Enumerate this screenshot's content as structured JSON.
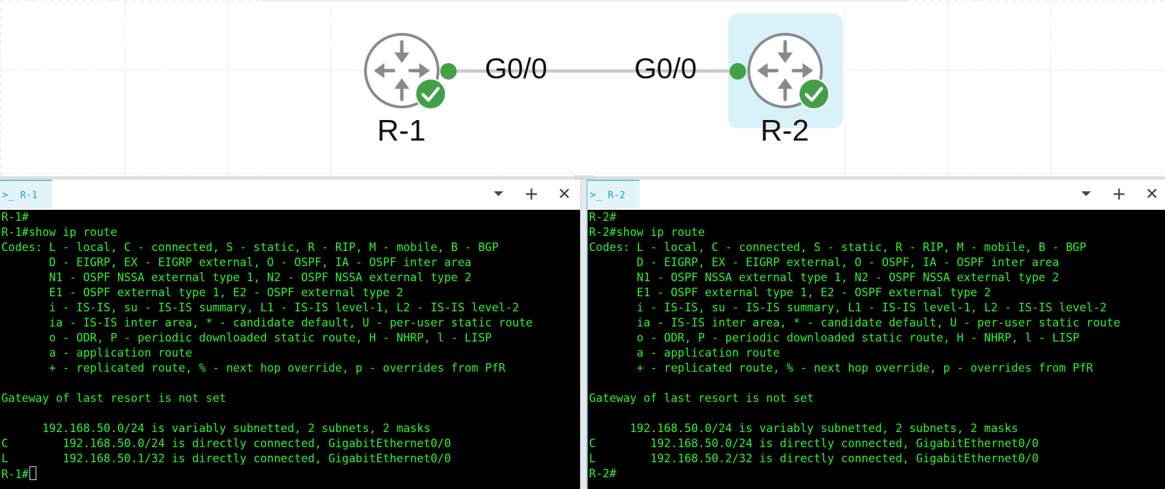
{
  "topology": {
    "nodes": [
      {
        "label": "R-1",
        "status": "running",
        "selected": false
      },
      {
        "label": "R-2",
        "status": "running",
        "selected": true
      }
    ],
    "link": {
      "a_interface": "G0/0",
      "b_interface": "G0/0"
    },
    "colors": {
      "status_green": "#43a047",
      "router_gray": "#8a8a8a",
      "selection": "#d9f1f8"
    }
  },
  "consoles": [
    {
      "tab_label": "R-1",
      "lines": [
        "R-1#",
        "R-1#show ip route",
        "Codes: L - local, C - connected, S - static, R - RIP, M - mobile, B - BGP",
        "       D - EIGRP, EX - EIGRP external, O - OSPF, IA - OSPF inter area",
        "       N1 - OSPF NSSA external type 1, N2 - OSPF NSSA external type 2",
        "       E1 - OSPF external type 1, E2 - OSPF external type 2",
        "       i - IS-IS, su - IS-IS summary, L1 - IS-IS level-1, L2 - IS-IS level-2",
        "       ia - IS-IS inter area, * - candidate default, U - per-user static route",
        "       o - ODR, P - periodic downloaded static route, H - NHRP, l - LISP",
        "       a - application route",
        "       + - replicated route, % - next hop override, p - overrides from PfR",
        "",
        "Gateway of last resort is not set",
        "",
        "      192.168.50.0/24 is variably subnetted, 2 subnets, 2 masks",
        "C        192.168.50.0/24 is directly connected, GigabitEthernet0/0",
        "L        192.168.50.1/32 is directly connected, GigabitEthernet0/0"
      ],
      "prompt": "R-1#"
    },
    {
      "tab_label": "R-2",
      "lines": [
        "R-2#",
        "R-2#show ip route",
        "Codes: L - local, C - connected, S - static, R - RIP, M - mobile, B - BGP",
        "       D - EIGRP, EX - EIGRP external, O - OSPF, IA - OSPF inter area",
        "       N1 - OSPF NSSA external type 1, N2 - OSPF NSSA external type 2",
        "       E1 - OSPF external type 1, E2 - OSPF external type 2",
        "       i - IS-IS, su - IS-IS summary, L1 - IS-IS level-1, L2 - IS-IS level-2",
        "       ia - IS-IS inter area, * - candidate default, U - per-user static route",
        "       o - ODR, P - periodic downloaded static route, H - NHRP, l - LISP",
        "       a - application route",
        "       + - replicated route, % - next hop override, p - overrides from PfR",
        "",
        "Gateway of last resort is not set",
        "",
        "      192.168.50.0/24 is variably subnetted, 2 subnets, 2 masks",
        "C        192.168.50.0/24 is directly connected, GigabitEthernet0/0",
        "L        192.168.50.2/32 is directly connected, GigabitEthernet0/0"
      ],
      "prompt": "R-2#"
    }
  ],
  "icons": {
    "tab": "terminal-prompt-icon",
    "dropdown": "caret-down-icon",
    "add": "plus-icon",
    "close": "close-icon",
    "node": "router-icon",
    "status": "check-icon"
  },
  "terminal_color": "#2cf22c"
}
